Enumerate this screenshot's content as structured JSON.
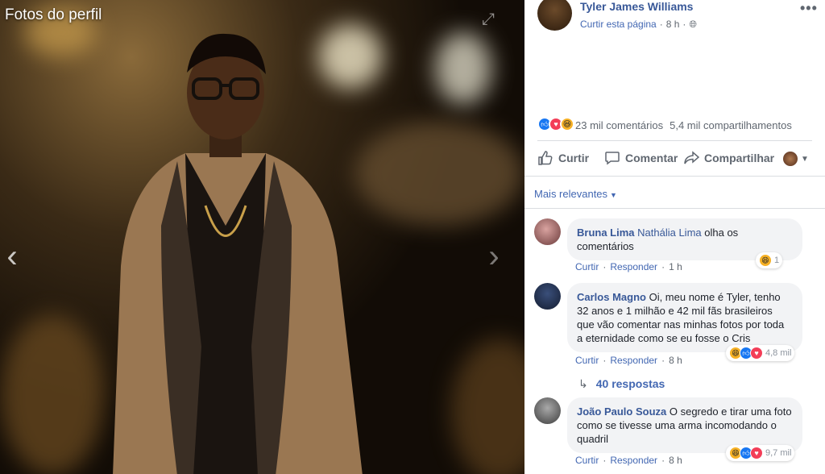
{
  "viewer": {
    "album_title": "Fotos do perfil",
    "prev_icon": "chevron-left-icon",
    "next_icon": "chevron-right-icon",
    "expand_icon": "expand-icon"
  },
  "post": {
    "page_name": "Tyler James Williams",
    "like_page": "Curtir esta página",
    "time": "8 h",
    "privacy_icon": "globe-icon",
    "more_icon": "ellipsis-icon",
    "comments_count": "23 mil comentários",
    "shares_count": "5,4 mil compartilhamentos",
    "reaction_icons": [
      "like-icon",
      "love-icon",
      "haha-icon"
    ],
    "actions": {
      "like": "Curtir",
      "comment": "Comentar",
      "share": "Compartilhar"
    },
    "sort_label": "Mais relevantes"
  },
  "comments": [
    {
      "author": "Bruna Lima",
      "tag": "Nathália Lima",
      "text": " olha os comentários",
      "like": "Curtir",
      "reply": "Responder",
      "time": "1 h",
      "reaction_count": "1"
    },
    {
      "author": "Carlos Magno",
      "text": " Oi, meu nome é Tyler, tenho 32 anos e 1 milhão e 42 mil fãs brasileiros que vão comentar nas minhas fotos por toda a eternidade como se eu fosse o Cris",
      "like": "Curtir",
      "reply": "Responder",
      "time": "8 h",
      "reaction_count": "4,8 mil",
      "replies": "40 respostas"
    },
    {
      "author": "João Paulo Souza",
      "text": " O segredo e tirar uma foto como se tivesse uma arma incomodando o quadril",
      "like": "Curtir",
      "reply": "Responder",
      "time": "8 h",
      "reaction_count": "9,7 mil"
    }
  ],
  "colors": {
    "link": "#385898",
    "muted": "#606770",
    "bubble": "#f2f3f5",
    "like_blue": "#1877f2",
    "love_red": "#f33e58",
    "haha_yellow": "#f7b125"
  }
}
